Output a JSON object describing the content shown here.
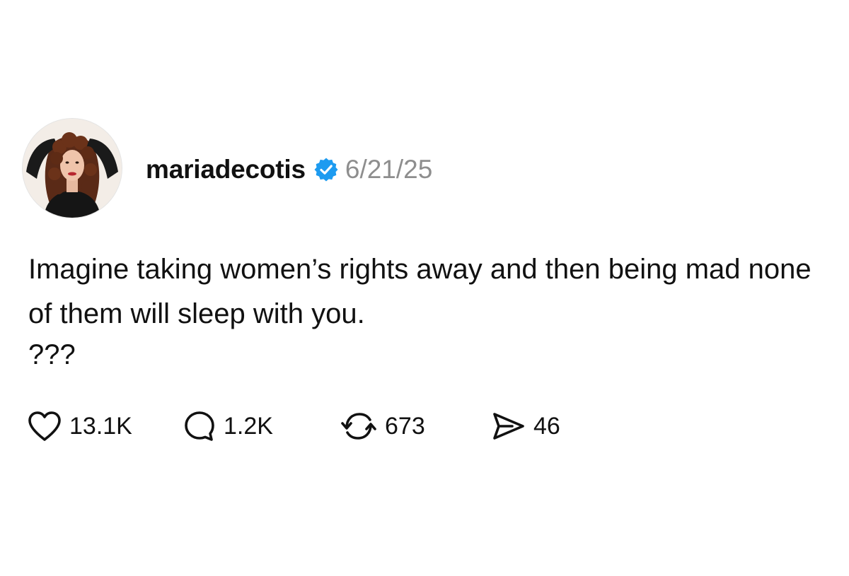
{
  "post": {
    "username": "mariadecotis",
    "verified": true,
    "date": "6/21/25",
    "text_line1": "Imagine taking women’s rights away and then being mad none of them will sleep with you.",
    "text_line2": "???"
  },
  "actions": {
    "likes": "13.1K",
    "comments": "1.2K",
    "reposts": "673",
    "shares": "46"
  },
  "icons": {
    "like": "heart-icon",
    "comment": "comment-bubble-icon",
    "repost": "repost-icon",
    "share": "send-icon",
    "verified": "verified-badge-icon"
  },
  "colors": {
    "verified_badge": "#1d9bf0",
    "date_text": "#8e8e8e"
  }
}
